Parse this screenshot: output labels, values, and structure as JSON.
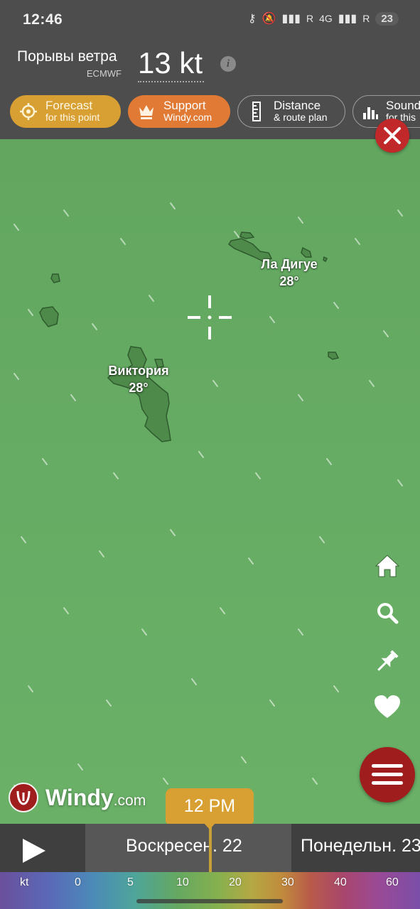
{
  "status_bar": {
    "time": "12:46",
    "signal_1": "R",
    "network": "4G",
    "signal_2": "R",
    "battery": "23"
  },
  "header": {
    "metric_title": "Порывы ветра",
    "model": "ECMWF",
    "value": "13 kt"
  },
  "actions": [
    {
      "line1": "Forecast",
      "line2": "for this point"
    },
    {
      "line1": "Support",
      "line2": "Windy.com"
    },
    {
      "line1": "Distance",
      "line2": "& route plan"
    },
    {
      "line1": "Sounding",
      "line2": "for this"
    }
  ],
  "map": {
    "islands": [
      {
        "name": "Ла Дигуе",
        "temp": "28°"
      },
      {
        "name": "Виктория",
        "temp": "28°"
      }
    ]
  },
  "logo": {
    "brand": "Windy",
    "suffix": ".com"
  },
  "timeline": {
    "current_time": "12 PM",
    "day_current": "Воскресен. 22",
    "day_next": "Понедельн. 23"
  },
  "legend": {
    "unit": "kt",
    "ticks": [
      "0",
      "5",
      "10",
      "20",
      "30",
      "40",
      "60"
    ]
  },
  "colors": {
    "header_bg": "#4d4d4d",
    "map_green": "#64a862",
    "forecast_pill": "#d8a032",
    "support_pill": "#e07a35",
    "close_red": "#c0282a",
    "menu_red": "#a01d1d",
    "time_marker": "#d8a032"
  }
}
